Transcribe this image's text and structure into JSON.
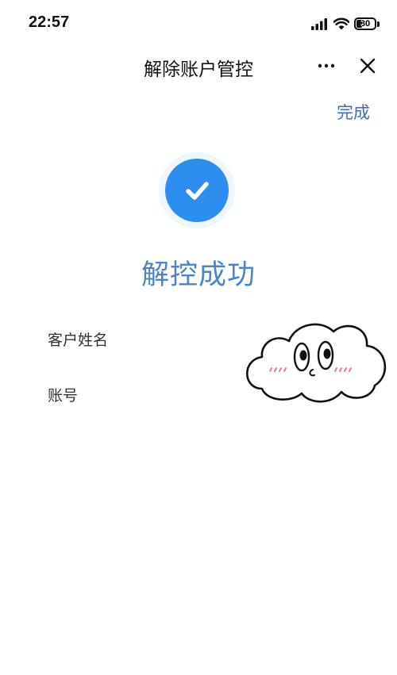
{
  "status_bar": {
    "time": "22:57",
    "battery_level": "30",
    "battery_fraction": 0.3,
    "icons": [
      "signal-icon",
      "wifi-icon",
      "battery-icon"
    ]
  },
  "nav": {
    "title": "解除账户管控",
    "more_icon": "more-icon",
    "close_icon": "close-icon"
  },
  "header_action": {
    "done_label": "完成"
  },
  "result": {
    "icon": "check-circle-icon",
    "title": "解控成功",
    "accent_color": "#2d8ef0"
  },
  "info": {
    "name_label": "客户姓名",
    "name_value": "",
    "account_label": "账号",
    "account_value": ""
  },
  "overlay": {
    "sticker": "cloud-face-sticker"
  }
}
